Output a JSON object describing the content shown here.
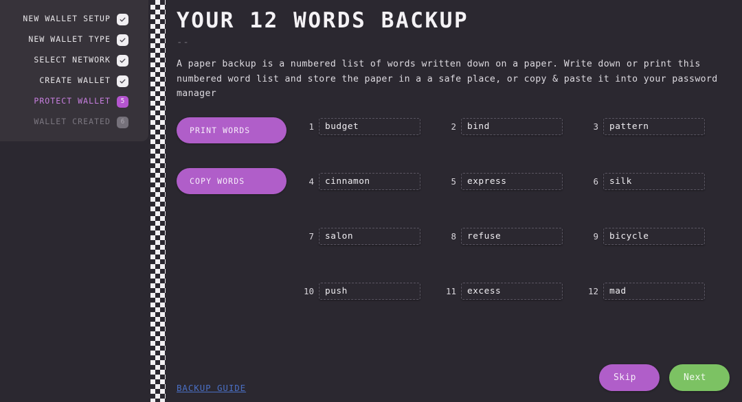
{
  "sidebar": {
    "steps": [
      {
        "label": "NEW WALLET SETUP",
        "badge": "✓",
        "state": "done"
      },
      {
        "label": "NEW WALLET TYPE",
        "badge": "✓",
        "state": "done"
      },
      {
        "label": "SELECT NETWORK",
        "badge": "✓",
        "state": "done"
      },
      {
        "label": "CREATE WALLET",
        "badge": "✓",
        "state": "done"
      },
      {
        "label": "PROTECT WALLET",
        "badge": "5",
        "state": "active"
      },
      {
        "label": "WALLET CREATED",
        "badge": "6",
        "state": "pending"
      }
    ]
  },
  "main": {
    "title": "YOUR 12 WORDS BACKUP",
    "rule": "--",
    "description": "A paper backup is a numbered list of words written down on a paper. Write down or print this numbered word list and store the paper in a a safe place, or copy & paste it into your password manager",
    "print_button": "PRINT WORDS",
    "copy_button": "COPY WORDS",
    "words": [
      {
        "num": "1",
        "value": "budget"
      },
      {
        "num": "2",
        "value": "bind"
      },
      {
        "num": "3",
        "value": "pattern"
      },
      {
        "num": "4",
        "value": "cinnamon"
      },
      {
        "num": "5",
        "value": "express"
      },
      {
        "num": "6",
        "value": "silk"
      },
      {
        "num": "7",
        "value": "salon"
      },
      {
        "num": "8",
        "value": "refuse"
      },
      {
        "num": "9",
        "value": "bicycle"
      },
      {
        "num": "10",
        "value": "push"
      },
      {
        "num": "11",
        "value": "excess"
      },
      {
        "num": "12",
        "value": "mad"
      }
    ]
  },
  "footer": {
    "guide_link": "BACKUP GUIDE",
    "skip_button": "Skip",
    "next_button": "Next"
  },
  "colors": {
    "accent_purple": "#b05ec9",
    "accent_green": "#7cc263",
    "link_blue": "#4a6fc4",
    "sidebar_bg": "#37333a",
    "page_bg": "#2b2830",
    "active_step_text": "#c87fe0"
  }
}
